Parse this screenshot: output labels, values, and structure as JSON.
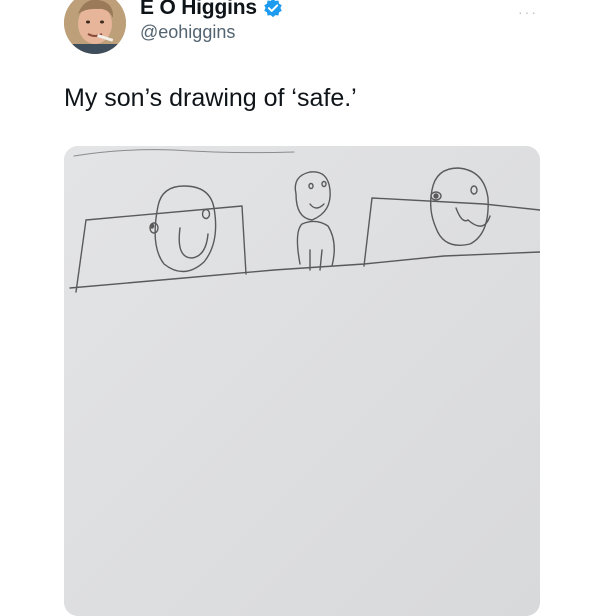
{
  "author": {
    "display_name": "E O Higgins",
    "handle": "@eohiggins",
    "verified": true,
    "avatar_icon": "profile-photo"
  },
  "more_label": "···",
  "tweet": {
    "text": "My son’s drawing of ‘safe.’"
  },
  "colors": {
    "verified_badge": "#1d9bf0",
    "handle_text": "#536471",
    "paper": "#dedfe1",
    "pencil": "#555555"
  }
}
